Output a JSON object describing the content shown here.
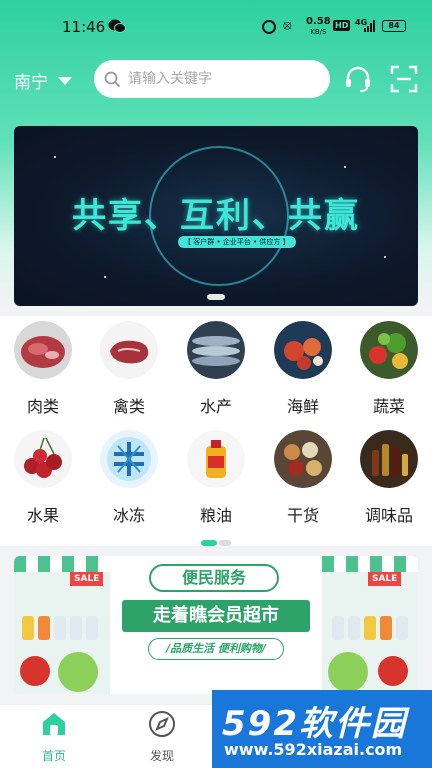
{
  "status_bar": {
    "time": "11:46",
    "net_speed": "0.58",
    "net_unit": "KB/S",
    "hd": "HD",
    "signal": "4G",
    "battery": "84"
  },
  "header": {
    "city": "南宁",
    "search_placeholder": "请输入关键字",
    "icons": [
      "headset-icon",
      "scan-icon"
    ]
  },
  "banner": {
    "title": "共享、互利、共赢",
    "subtitle": "【 客户群 • 企业平台 • 供应方 】"
  },
  "categories": [
    {
      "label": "肉类",
      "icon": "meat-image"
    },
    {
      "label": "禽类",
      "icon": "poultry-image"
    },
    {
      "label": "水产",
      "icon": "aquatic-image"
    },
    {
      "label": "海鲜",
      "icon": "seafood-image"
    },
    {
      "label": "蔬菜",
      "icon": "vegetable-image"
    },
    {
      "label": "水果",
      "icon": "fruit-image"
    },
    {
      "label": "冰冻",
      "icon": "frozen-image"
    },
    {
      "label": "粮油",
      "icon": "grain-oil-image"
    },
    {
      "label": "干货",
      "icon": "dried-goods-image"
    },
    {
      "label": "调味品",
      "icon": "seasoning-image"
    }
  ],
  "promo": {
    "title": "便民服务",
    "main": "走着瞧会员超市",
    "sub": "/品质生活 便利购物/",
    "sale": "SALE"
  },
  "bottom_nav": [
    {
      "label": "首页",
      "icon": "home-icon",
      "active": true
    },
    {
      "label": "发现",
      "icon": "discover-icon",
      "active": false
    }
  ],
  "watermark": {
    "main": "592软件园",
    "sub": "www.592xiazai.com"
  },
  "colors": {
    "accent": "#2fd0a0",
    "promo_green": "#2da36a",
    "banner_text": "#3ee6d7"
  }
}
